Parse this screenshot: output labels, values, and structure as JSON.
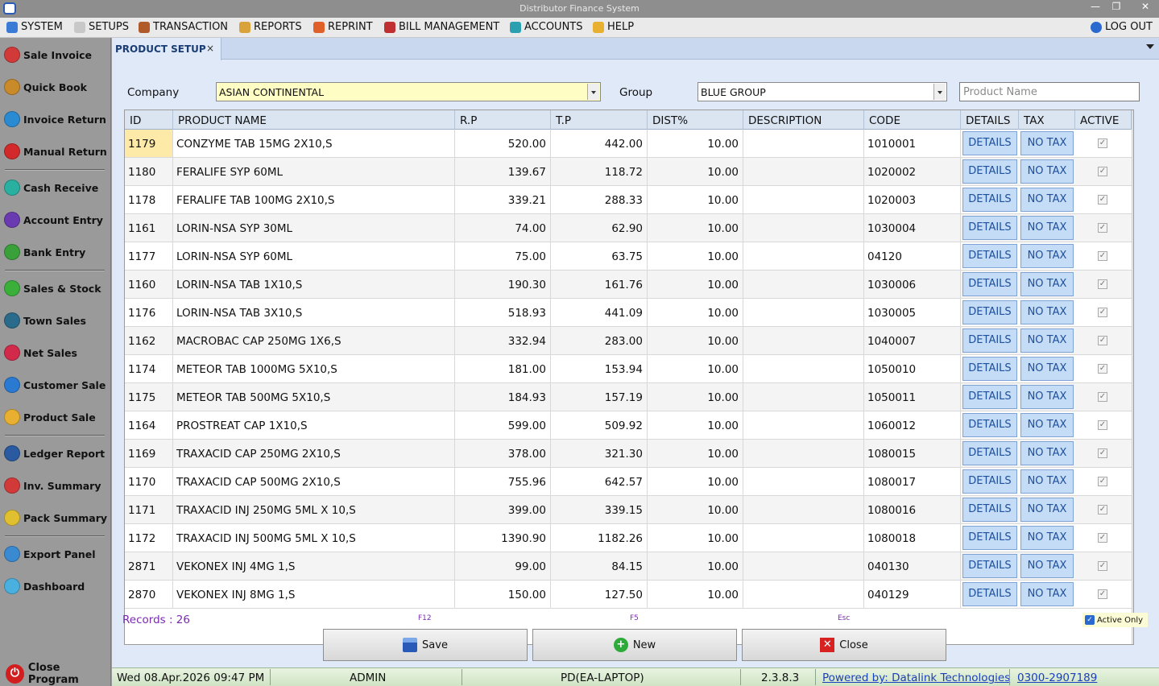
{
  "window": {
    "title": "Distributor Finance System"
  },
  "menu": [
    {
      "id": "system",
      "label": "SYSTEM",
      "icon": "monitor-icon",
      "color": "#3a7bd5"
    },
    {
      "id": "setups",
      "label": "SETUPS",
      "icon": "document-icon",
      "color": "#c8c8c8"
    },
    {
      "id": "transaction",
      "label": "TRANSACTION",
      "icon": "tools-icon",
      "color": "#b05a2a"
    },
    {
      "id": "reports",
      "label": "REPORTS",
      "icon": "report-icon",
      "color": "#d9a23a"
    },
    {
      "id": "reprint",
      "label": "REPRINT",
      "icon": "reprint-icon",
      "color": "#e0602a"
    },
    {
      "id": "bill-management",
      "label": "BILL MANAGEMENT",
      "icon": "printer-icon",
      "color": "#c03030"
    },
    {
      "id": "accounts",
      "label": "ACCOUNTS",
      "icon": "globe-icon",
      "color": "#2aa0b0"
    },
    {
      "id": "help",
      "label": "HELP",
      "icon": "help-icon",
      "color": "#e8b030"
    }
  ],
  "logout": {
    "label": "LOG OUT",
    "icon": "lock-icon"
  },
  "sidebar": {
    "items": [
      {
        "label": "Sale Invoice",
        "icon": "sale-invoice-icon",
        "color": "#d23a3a"
      },
      {
        "label": "Quick Book",
        "icon": "quick-book-icon",
        "color": "#c98a2a"
      },
      {
        "label": "Invoice Return",
        "icon": "invoice-return-icon",
        "color": "#2a8ad2"
      },
      {
        "label": "Manual Return",
        "icon": "manual-return-icon",
        "color": "#d22a2a"
      },
      {
        "label": "Cash Receive",
        "icon": "cash-receive-icon",
        "color": "#2ab0a0"
      },
      {
        "label": "Account Entry",
        "icon": "account-entry-icon",
        "color": "#6a3ab0"
      },
      {
        "label": "Bank Entry",
        "icon": "bank-entry-icon",
        "color": "#3aa03a"
      },
      {
        "label": "Sales & Stock",
        "icon": "sales-stock-icon",
        "color": "#3ab03a"
      },
      {
        "label": "Town Sales",
        "icon": "town-sales-icon",
        "color": "#2a6a8a"
      },
      {
        "label": "Net Sales",
        "icon": "net-sales-icon",
        "color": "#d22a4a"
      },
      {
        "label": "Customer Sale",
        "icon": "customer-sale-icon",
        "color": "#2a7ad2"
      },
      {
        "label": "Product Sale",
        "icon": "product-sale-icon",
        "color": "#e8b030"
      },
      {
        "label": "Ledger Report",
        "icon": "ledger-report-icon",
        "color": "#2a5aa0"
      },
      {
        "label": "Inv. Summary",
        "icon": "inv-summary-icon",
        "color": "#d23a3a"
      },
      {
        "label": "Pack Summary",
        "icon": "pack-summary-icon",
        "color": "#e0c030"
      },
      {
        "label": "Export Panel",
        "icon": "export-panel-icon",
        "color": "#3a8ad2"
      },
      {
        "label": "Dashboard",
        "icon": "dashboard-icon",
        "color": "#4ab0e0"
      }
    ],
    "close_label": "Close Program"
  },
  "tab": {
    "label": "PRODUCT SETUP",
    "close": "×"
  },
  "filters": {
    "company_label": "Company",
    "company_value": "ASIAN CONTINENTAL",
    "group_label": "Group",
    "group_value": "BLUE GROUP",
    "product_placeholder": "Product Name"
  },
  "grid": {
    "columns": [
      "ID",
      "PRODUCT NAME",
      "R.P",
      "T.P",
      "DIST%",
      "DESCRIPTION",
      "CODE",
      "DETAILS",
      "TAX",
      "ACTIVE"
    ],
    "details_label": "DETAILS",
    "tax_label": "NO TAX",
    "check_mark": "✓",
    "rows": [
      {
        "id": "1179",
        "name": "CONZYME TAB 15MG 2X10,S",
        "rp": "520.00",
        "tp": "442.00",
        "dist": "10.00",
        "desc": "",
        "code": "1010001"
      },
      {
        "id": "1180",
        "name": "FERALIFE SYP 60ML",
        "rp": "139.67",
        "tp": "118.72",
        "dist": "10.00",
        "desc": "",
        "code": "1020002"
      },
      {
        "id": "1178",
        "name": "FERALIFE TAB 100MG 2X10,S",
        "rp": "339.21",
        "tp": "288.33",
        "dist": "10.00",
        "desc": "",
        "code": "1020003"
      },
      {
        "id": "1161",
        "name": "LORIN-NSA SYP 30ML",
        "rp": "74.00",
        "tp": "62.90",
        "dist": "10.00",
        "desc": "",
        "code": "1030004"
      },
      {
        "id": "1177",
        "name": "LORIN-NSA SYP 60ML",
        "rp": "75.00",
        "tp": "63.75",
        "dist": "10.00",
        "desc": "",
        "code": "04120"
      },
      {
        "id": "1160",
        "name": "LORIN-NSA TAB 1X10,S",
        "rp": "190.30",
        "tp": "161.76",
        "dist": "10.00",
        "desc": "",
        "code": "1030006"
      },
      {
        "id": "1176",
        "name": "LORIN-NSA TAB 3X10,S",
        "rp": "518.93",
        "tp": "441.09",
        "dist": "10.00",
        "desc": "",
        "code": "1030005"
      },
      {
        "id": "1162",
        "name": "MACROBAC CAP 250MG 1X6,S",
        "rp": "332.94",
        "tp": "283.00",
        "dist": "10.00",
        "desc": "",
        "code": "1040007"
      },
      {
        "id": "1174",
        "name": "METEOR TAB 1000MG 5X10,S",
        "rp": "181.00",
        "tp": "153.94",
        "dist": "10.00",
        "desc": "",
        "code": "1050010"
      },
      {
        "id": "1175",
        "name": "METEOR TAB 500MG 5X10,S",
        "rp": "184.93",
        "tp": "157.19",
        "dist": "10.00",
        "desc": "",
        "code": "1050011"
      },
      {
        "id": "1164",
        "name": "PROSTREAT CAP 1X10,S",
        "rp": "599.00",
        "tp": "509.92",
        "dist": "10.00",
        "desc": "",
        "code": "1060012"
      },
      {
        "id": "1169",
        "name": "TRAXACID CAP 250MG 2X10,S",
        "rp": "378.00",
        "tp": "321.30",
        "dist": "10.00",
        "desc": "",
        "code": "1080015"
      },
      {
        "id": "1170",
        "name": "TRAXACID CAP 500MG 2X10,S",
        "rp": "755.96",
        "tp": "642.57",
        "dist": "10.00",
        "desc": "",
        "code": "1080017"
      },
      {
        "id": "1171",
        "name": "TRAXACID INJ 250MG 5ML X 10,S",
        "rp": "399.00",
        "tp": "339.15",
        "dist": "10.00",
        "desc": "",
        "code": "1080016"
      },
      {
        "id": "1172",
        "name": "TRAXACID INJ 500MG 5ML X 10,S",
        "rp": "1390.90",
        "tp": "1182.26",
        "dist": "10.00",
        "desc": "",
        "code": "1080018"
      },
      {
        "id": "2871",
        "name": "VEKONEX INJ 4MG 1,S",
        "rp": "99.00",
        "tp": "84.15",
        "dist": "10.00",
        "desc": "",
        "code": "040130"
      },
      {
        "id": "2870",
        "name": "VEKONEX INJ 8MG 1,S",
        "rp": "150.00",
        "tp": "127.50",
        "dist": "10.00",
        "desc": "",
        "code": "040129"
      }
    ]
  },
  "footer": {
    "records": "Records : 26",
    "f12": "F12",
    "f5": "F5",
    "esc": "Esc",
    "active_only": "Active Only",
    "save": "Save",
    "new": "New",
    "close": "Close"
  },
  "status": {
    "datetime": "Wed 08.Apr.2026  09:47 PM",
    "user": "ADMIN",
    "machine": "PD(EA-LAPTOP)",
    "version": "2.3.8.3",
    "powered": "Powered by: Datalink Technologies",
    "phone": "0300-2907189"
  },
  "colors": {
    "accent": "#1d4f9c",
    "highlight": "#fdfdc4",
    "status": "#cfe4c4"
  }
}
